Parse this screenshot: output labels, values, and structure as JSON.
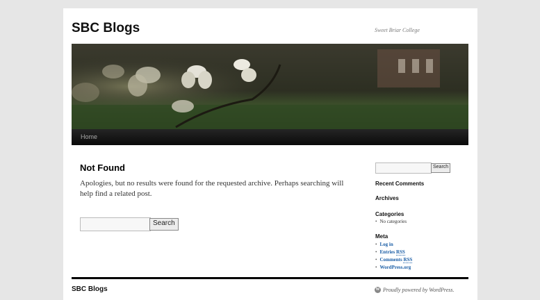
{
  "site": {
    "title": "SBC Blogs",
    "description": "Sweet Briar College"
  },
  "nav": {
    "items": [
      {
        "label": "Home"
      }
    ]
  },
  "main": {
    "title": "Not Found",
    "text": "Apologies, but no results were found for the requested archive. Perhaps searching will help find a related post.",
    "search": {
      "value": "",
      "button_label": "Search"
    }
  },
  "sidebar": {
    "search": {
      "value": "",
      "button_label": "Search"
    },
    "recent_comments": {
      "title": "Recent Comments"
    },
    "archives": {
      "title": "Archives"
    },
    "categories": {
      "title": "Categories",
      "items": [
        "No categories"
      ]
    },
    "meta": {
      "title": "Meta",
      "links": [
        {
          "label": "Log in"
        },
        {
          "label": "Entries ",
          "abbr": "RSS"
        },
        {
          "label": "Comments ",
          "abbr": "RSS"
        },
        {
          "label": "WordPress.org"
        }
      ]
    }
  },
  "footer": {
    "title": "SBC Blogs",
    "powered": "Proudly powered by WordPress.",
    "icon": "wordpress-icon"
  },
  "colors": {
    "page_bg": "#e6e6e6",
    "nav_bg": "#0a0a0a",
    "link": "#1b5ea6"
  }
}
